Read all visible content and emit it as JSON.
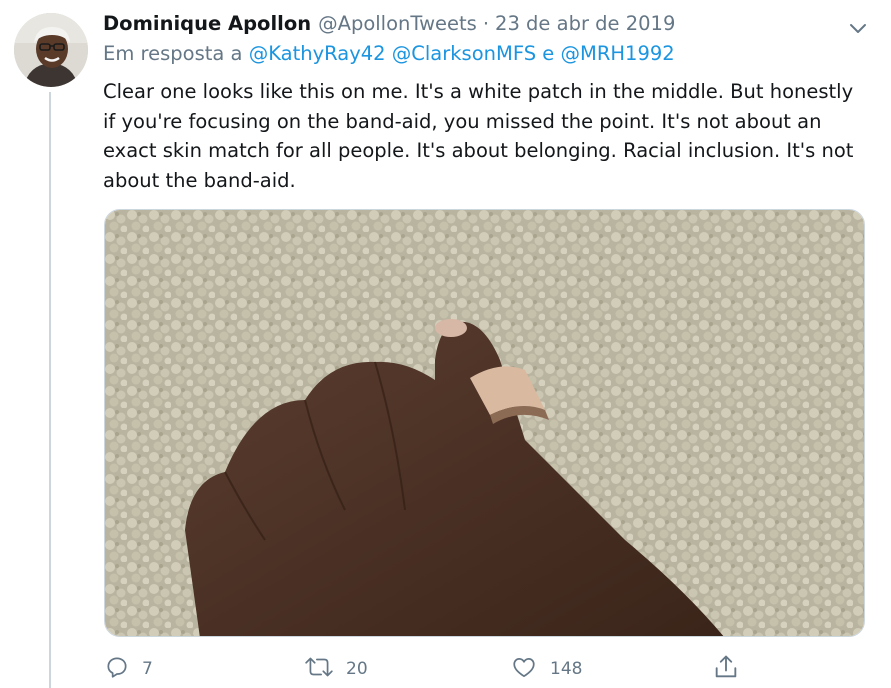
{
  "author": {
    "name": "Dominique Apollon",
    "handle": "@ApollonTweets",
    "separator": "·",
    "date": "23 de abr de 2019"
  },
  "reply": {
    "prefix": "Em resposta a",
    "mentions": [
      "@KathyRay42",
      "@ClarksonMFS",
      "@MRH1992"
    ],
    "conjunction": "e"
  },
  "text": "Clear one looks like this on me. It's a white patch in the middle. But honestly\nif you're focusing on the band-aid, you missed the point. It's not about an\nexact skin match for all people. It's about belonging. Racial inclusion. It's not\nabout the band-aid.",
  "actions": {
    "reply_count": "7",
    "retweet_count": "20",
    "like_count": "148"
  },
  "colors": {
    "link": "#1b95e0",
    "secondary_text": "#657786",
    "primary_text": "#14171a",
    "border": "#ccd6dd"
  },
  "icons": [
    "chevron-down-icon",
    "reply-icon",
    "retweet-icon",
    "heart-icon",
    "share-icon"
  ]
}
